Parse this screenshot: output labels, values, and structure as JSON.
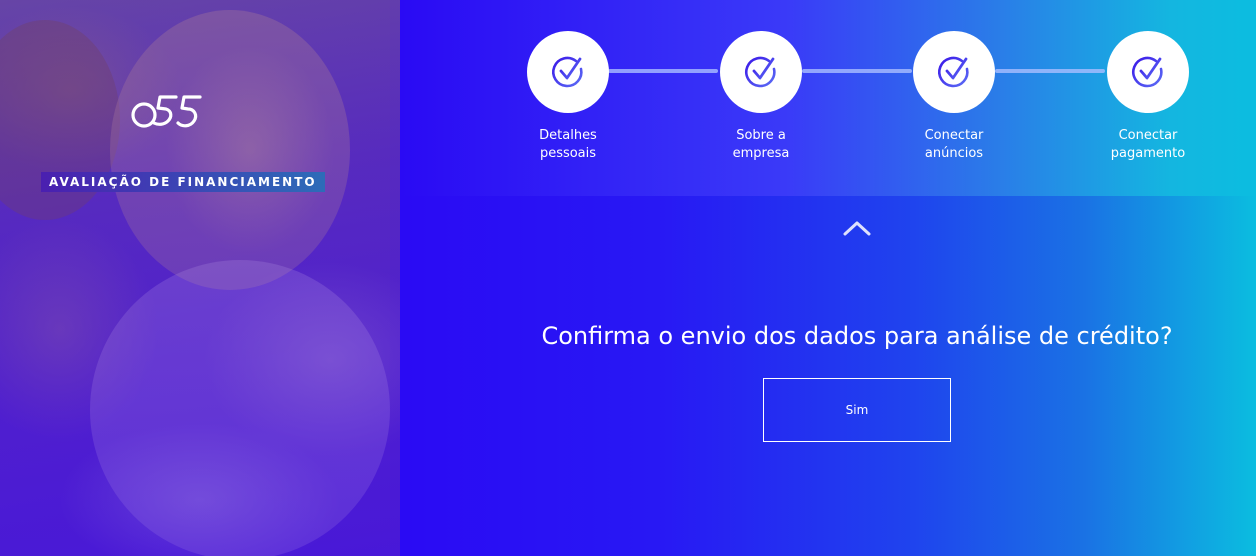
{
  "hero": {
    "logo_text": "o55",
    "badge": "AVALIAÇÃO DE FINANCIAMENTO"
  },
  "stepper": {
    "steps": [
      {
        "label": "Detalhes\npessoais",
        "status": "completed",
        "icon": "check-icon"
      },
      {
        "label": "Sobre a\nempresa",
        "status": "completed",
        "icon": "check-icon"
      },
      {
        "label": "Conectar\nanúncios",
        "status": "completed",
        "icon": "check-icon"
      },
      {
        "label": "Conectar\npagamento",
        "status": "completed",
        "icon": "check-icon"
      }
    ]
  },
  "collapse_icon": "chevron-up-icon",
  "confirm": {
    "question": "Confirma o envio dos dados para análise de crédito?",
    "yes_label": "Sim"
  },
  "colors": {
    "primary": "#2a0af4",
    "accent": "#0bbde0",
    "check": "#3f2ae0",
    "text": "#ffffff"
  }
}
